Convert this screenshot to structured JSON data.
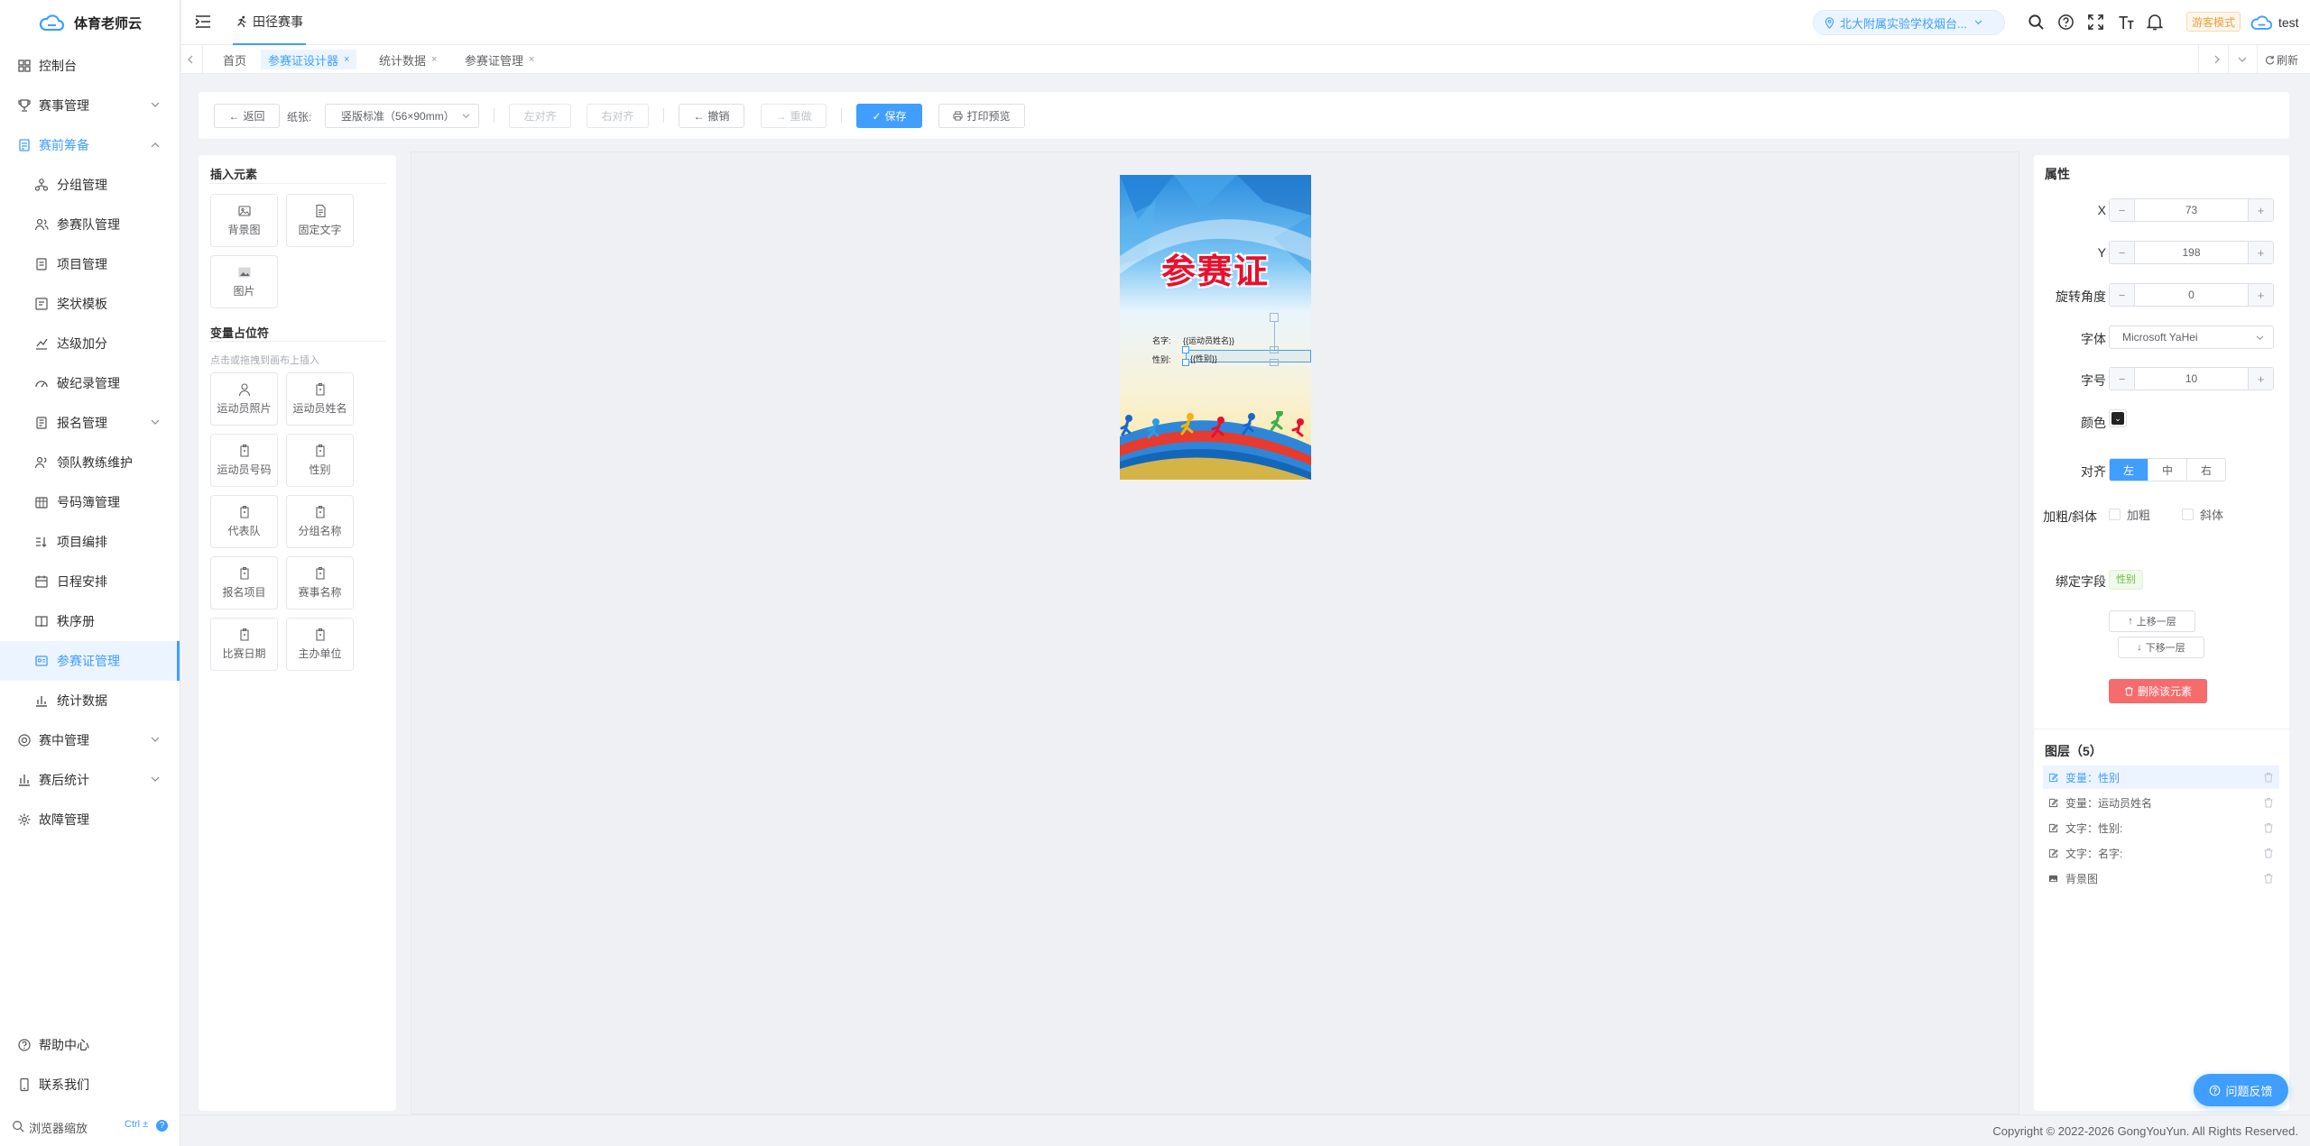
{
  "app": {
    "name": "体育老师云"
  },
  "sidebar": {
    "items": [
      {
        "label": "控制台"
      },
      {
        "label": "赛事管理"
      },
      {
        "label": "赛前筹备"
      },
      {
        "label": "分组管理"
      },
      {
        "label": "参赛队管理"
      },
      {
        "label": "项目管理"
      },
      {
        "label": "奖状模板"
      },
      {
        "label": "达级加分"
      },
      {
        "label": "破纪录管理"
      },
      {
        "label": "报名管理"
      },
      {
        "label": "领队教练维护"
      },
      {
        "label": "号码簿管理"
      },
      {
        "label": "项目编排"
      },
      {
        "label": "日程安排"
      },
      {
        "label": "秩序册"
      },
      {
        "label": "参赛证管理"
      },
      {
        "label": "统计数据"
      },
      {
        "label": "赛中管理"
      },
      {
        "label": "赛后统计"
      },
      {
        "label": "故障管理"
      }
    ],
    "help": "帮助中心",
    "contact": "联系我们",
    "zoom_label": "浏览器缩放",
    "zoom_shortcut": "Ctrl ±"
  },
  "header": {
    "event_title": "田径赛事",
    "school": "北大附属实验学校烟台...",
    "mode_badge": "游客模式",
    "user": "test"
  },
  "tabs": [
    {
      "label": "首页"
    },
    {
      "label": "参赛证设计器"
    },
    {
      "label": "统计数据"
    },
    {
      "label": "参赛证管理"
    }
  ],
  "tabs_refresh": "刷新",
  "toolbar": {
    "back": "返回",
    "paper_label": "纸张:",
    "paper_value": "竖版标准（56×90mm）",
    "align_left": "左对齐",
    "align_right": "右对齐",
    "undo": "撤销",
    "redo": "重做",
    "save": "保存",
    "print_preview": "打印预览"
  },
  "left_panel": {
    "insert_title": "插入元素",
    "insert_items": [
      {
        "label": "背景图",
        "icon": "image-icon"
      },
      {
        "label": "固定文字",
        "icon": "document-icon"
      },
      {
        "label": "图片",
        "icon": "picture-icon"
      }
    ],
    "vars_title": "变量占位符",
    "vars_hint": "点击或拖拽到画布上插入",
    "vars": [
      {
        "label": "运动员照片",
        "icon": "user-icon"
      },
      {
        "label": "运动员姓名",
        "icon": "tag-icon"
      },
      {
        "label": "运动员号码",
        "icon": "tag-icon"
      },
      {
        "label": "性别",
        "icon": "tag-icon"
      },
      {
        "label": "代表队",
        "icon": "tag-icon"
      },
      {
        "label": "分组名称",
        "icon": "tag-icon"
      },
      {
        "label": "报名项目",
        "icon": "tag-icon"
      },
      {
        "label": "赛事名称",
        "icon": "tag-icon"
      },
      {
        "label": "比赛日期",
        "icon": "tag-icon"
      },
      {
        "label": "主办单位",
        "icon": "tag-icon"
      }
    ]
  },
  "card": {
    "title": "参赛证",
    "name_label": "名字:",
    "name_value": "{{运动员姓名}}",
    "gender_label": "性别:",
    "gender_value": "{{性别}}"
  },
  "properties": {
    "title": "属性",
    "x_label": "X",
    "x_value": "73",
    "y_label": "Y",
    "y_value": "198",
    "rotation_label": "旋转角度",
    "rotation_value": "0",
    "font_label": "字体",
    "font_value": "Microsoft YaHei",
    "size_label": "字号",
    "size_value": "10",
    "color_label": "颜色",
    "color_value": "#222222",
    "align_label": "对齐",
    "align_options": [
      "左",
      "中",
      "右"
    ],
    "align_selected": "左",
    "style_label": "加粗/斜体",
    "bold_label": "加粗",
    "italic_label": "斜体",
    "bind_label": "绑定字段",
    "bind_value": "性别",
    "up_label": "上移一层",
    "down_label": "下移一层",
    "delete_label": "删除该元素"
  },
  "layers": {
    "title": "图层（5）",
    "items": [
      {
        "label": "变量：性别",
        "selected": true
      },
      {
        "label": "变量：运动员姓名"
      },
      {
        "label": "文字：性别:"
      },
      {
        "label": "文字：名字:"
      },
      {
        "label": "背景图"
      }
    ]
  },
  "feedback": "问题反馈",
  "footer": "Copyright © 2022-2026 GongYouYun. All Rights Reserved.",
  "colors": {
    "primary": "#409eff",
    "danger": "#f56c6c",
    "card_title": "#e8102e"
  }
}
